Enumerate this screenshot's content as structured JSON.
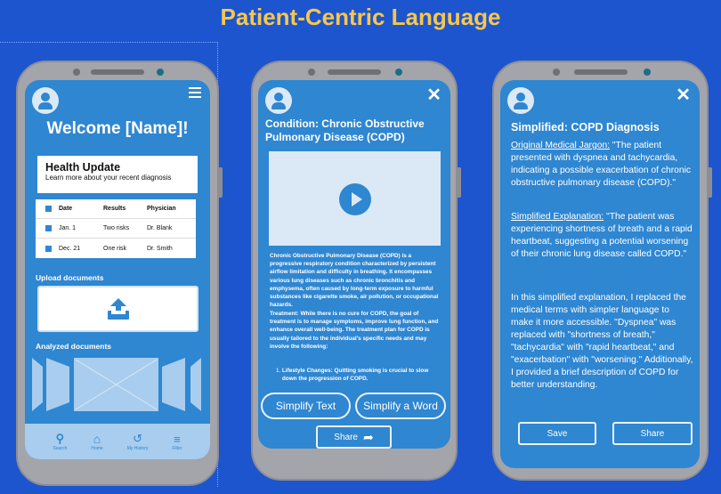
{
  "title": "Patient-Centric Language",
  "screen1": {
    "welcome": "Welcome [Name]!",
    "health_title": "Health Update",
    "health_sub": "Learn more about your recent diagnosis",
    "table": {
      "headers": [
        "Date",
        "Results",
        "Physician"
      ],
      "rows": [
        [
          "Jan. 1",
          "Two risks",
          "Dr. Blank"
        ],
        [
          "Dec. 21",
          "One risk",
          "Dr. Smith"
        ]
      ]
    },
    "upload_label": "Upload documents",
    "analyzed_label": "Analyzed documents",
    "nav": [
      {
        "icon": "search-icon",
        "label": "Search"
      },
      {
        "icon": "home-icon",
        "label": "Home"
      },
      {
        "icon": "history-icon",
        "label": "My History"
      },
      {
        "icon": "filter-icon",
        "label": "Filter"
      }
    ]
  },
  "screen2": {
    "heading": "Condition: Chronic Obstructive Pulmonary Disease (COPD)",
    "para1": "Chronic Obstructive Pulmonary Disease (COPD) is a progressive respiratory condition characterized by persistent airflow limitation and difficulty in breathing. It encompasses various lung diseases such as chronic bronchitis and emphysema, often caused by long-term exposure to harmful substances like cigarette smoke, air pollution, or occupational hazards.",
    "para2": "Treatment: While there is no cure for COPD, the goal of treatment is to manage symptoms, improve lung function, and enhance overall well-being. The treatment plan for COPD is usually tailored to the individual's specific needs and may involve the following:",
    "list_num": "1.",
    "list_item": "Lifestyle Changes: Quitting smoking is crucial to slow down the progression of COPD.",
    "simplify_text": "Simplify Text",
    "simplify_word": "Simplify a Word",
    "share": "Share"
  },
  "screen3": {
    "heading": "Simplified: COPD Diagnosis",
    "jargon_label": "Original Medical Jargon:",
    "jargon_text": " \"The patient presented with dyspnea and tachycardia, indicating a possible exacerbation of chronic obstructive pulmonary disease (COPD).\"",
    "simple_label": "Simplified Explanation:",
    "simple_text": " \"The patient was experiencing shortness of breath and a rapid heartbeat, suggesting a potential worsening of their chronic lung disease called COPD.\"",
    "explanation": "In this simplified explanation, I replaced the medical terms with simpler language to make it more accessible. \"Dyspnea\" was replaced with \"shortness of breath,\" \"tachycardia\" with \"rapid heartbeat,\" and \"exacerbation\" with \"worsening.\" Additionally, I provided a brief description of COPD for better understanding.",
    "save": "Save",
    "share": "Share"
  }
}
